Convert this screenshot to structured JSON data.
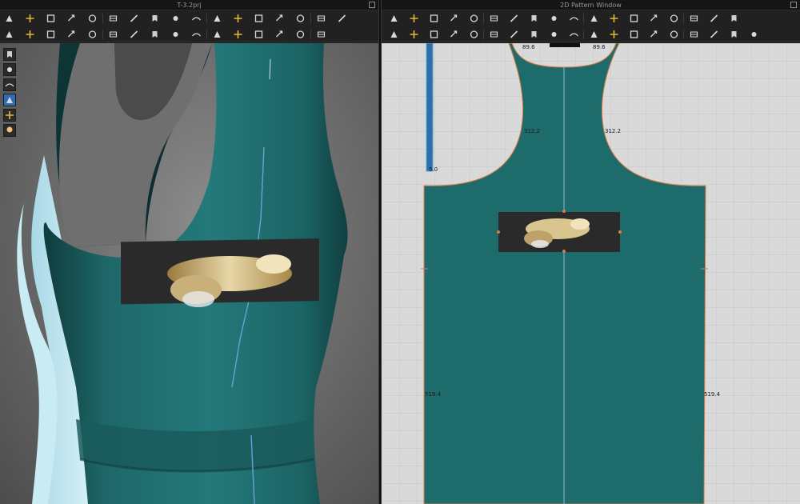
{
  "window": {
    "left_title": "T-3.2prj",
    "right_title": "2D Pattern Window"
  },
  "toolbar_3d": {
    "row1": [
      "select-move-icon",
      "transform-icon",
      "box-select-icon",
      "rotate-pattern-icon",
      "scale-icon",
      "fold-icon",
      "pin-icon",
      "tack-icon",
      "arrangement-icon",
      "measure-icon",
      "avatar-point-icon",
      "fabric-icon",
      "show-avatar-icon",
      "show-pattern-icon",
      "simulation-icon",
      "reset-icon",
      "zipper-icon"
    ],
    "row2": [
      "skeleton-icon",
      "texture-icon",
      "seamline-icon",
      "stitch-icon",
      "sewing-icon",
      "brush-icon",
      "fit-map-icon",
      "strain-map-icon",
      "stress-map-icon",
      "button-icon",
      "buttonhole-icon",
      "line-icon",
      "topstitch-icon",
      "trim-icon",
      "graphic-icon",
      "camera-icon"
    ]
  },
  "toolbar_2d": {
    "row1": [
      "select-pattern-icon",
      "edit-point-icon",
      "edit-curve-icon",
      "curve-point-icon",
      "add-point-icon",
      "segment-icon",
      "polygon-icon",
      "rectangle-icon",
      "ellipse-icon",
      "internal-polygon-icon",
      "internal-rect-icon",
      "internal-circle-icon",
      "dart-icon",
      "hole-icon",
      "trace-icon",
      "grading-icon",
      "unfold-icon",
      "notch-icon"
    ],
    "row2": [
      "segment-sewing-icon",
      "free-sewing-icon",
      "edit-sewing-icon",
      "fold-arrangement-icon",
      "texture-edit-icon",
      "graphic-2d-icon",
      "button-2d-icon",
      "buttonhole-2d-icon",
      "topstitch-2d-icon",
      "sticker-icon",
      "puckering-icon",
      "elastic-icon",
      "shirring-icon",
      "piping-icon",
      "line-edit-icon",
      "dashed-line-icon",
      "measure-2d-icon",
      "zigzag-icon",
      "ruler-icon"
    ]
  },
  "left_tools": [
    "garment-front-icon",
    "garment-back-icon",
    "avatar-icon",
    "pattern-view-icon",
    "eraser-icon",
    "avatar-skin-icon"
  ],
  "pattern_measurements": {
    "neck_left": "89.6",
    "neck_right": "89.6",
    "neck_top": "312.2",
    "armhole_left": "312.2",
    "armhole_right": "312.2",
    "side_left": "519.4",
    "side_right": "519.4",
    "strap": "5.0"
  },
  "colors": {
    "garment": "#1f6b6b",
    "garment_dark": "#184f50",
    "pattern_outline": "#e07a40",
    "seam_line": "#6aa0d8",
    "background_2d": "#d9d9d9"
  }
}
